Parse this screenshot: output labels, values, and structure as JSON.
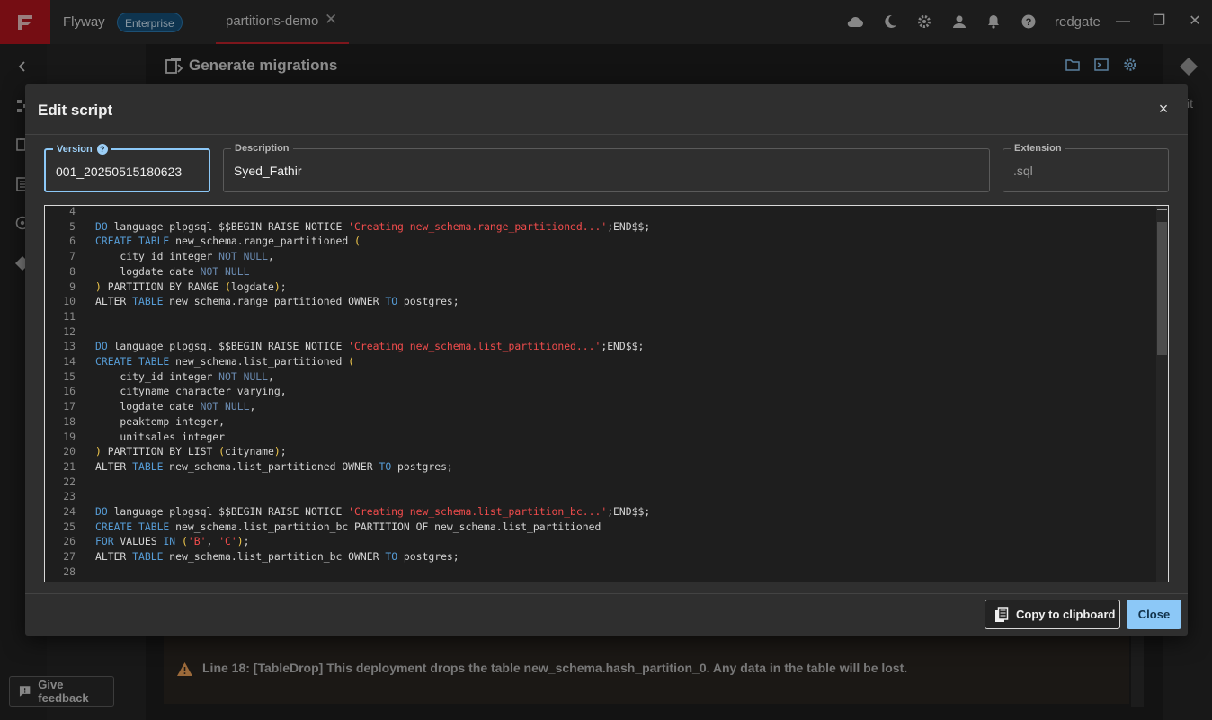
{
  "titlebar": {
    "app_name": "Flyway",
    "edition_badge": "Enterprise",
    "tab_label": "partitions-demo",
    "tab_close": "✕",
    "user": "redgate",
    "minimize": "—",
    "maximize": "❐",
    "close": "✕"
  },
  "background": {
    "page_title": "Generate migrations",
    "right_rail_text": "it",
    "warning_text": "Line 18: [TableDrop] This deployment drops the table new_schema.hash_partition_0. Any data in the table will be lost.",
    "feedback_label": "Give feedback"
  },
  "modal": {
    "title": "Edit script",
    "close_glyph": "×",
    "version": {
      "label": "Version",
      "help": "?",
      "value": "001_20250515180623"
    },
    "description": {
      "label": "Description",
      "value": "Syed_Fathir"
    },
    "extension": {
      "label": "Extension",
      "value": ".sql"
    },
    "copy_button": "Copy to clipboard",
    "close_button": "Close"
  },
  "code_lines": [
    {
      "n": "4",
      "tokens": []
    },
    {
      "n": "5",
      "tokens": [
        {
          "t": "kw",
          "s": "DO"
        },
        {
          "t": "",
          "s": " language plpgsql $$BEGIN RAISE NOTICE "
        },
        {
          "t": "str",
          "s": "'Creating new_schema.range_partitioned...'"
        },
        {
          "t": "",
          "s": ";END$$;"
        }
      ]
    },
    {
      "n": "6",
      "tokens": [
        {
          "t": "kw",
          "s": "CREATE TABLE"
        },
        {
          "t": "",
          "s": " new_schema.range_partitioned "
        },
        {
          "t": "par",
          "s": "("
        }
      ]
    },
    {
      "n": "7",
      "tokens": [
        {
          "t": "",
          "s": "    city_id integer "
        },
        {
          "t": "gr",
          "s": "NOT NULL"
        },
        {
          "t": "",
          "s": ","
        }
      ]
    },
    {
      "n": "8",
      "tokens": [
        {
          "t": "",
          "s": "    logdate date "
        },
        {
          "t": "gr",
          "s": "NOT NULL"
        }
      ]
    },
    {
      "n": "9",
      "tokens": [
        {
          "t": "par",
          "s": ")"
        },
        {
          "t": "",
          "s": " PARTITION BY RANGE "
        },
        {
          "t": "par",
          "s": "("
        },
        {
          "t": "",
          "s": "logdate"
        },
        {
          "t": "par",
          "s": ")"
        },
        {
          "t": "",
          "s": ";"
        }
      ]
    },
    {
      "n": "10",
      "tokens": [
        {
          "t": "",
          "s": "ALTER "
        },
        {
          "t": "kw",
          "s": "TABLE"
        },
        {
          "t": "",
          "s": " new_schema.range_partitioned OWNER "
        },
        {
          "t": "kw",
          "s": "TO"
        },
        {
          "t": "",
          "s": " postgres;"
        }
      ]
    },
    {
      "n": "11",
      "tokens": []
    },
    {
      "n": "12",
      "tokens": []
    },
    {
      "n": "13",
      "tokens": [
        {
          "t": "kw",
          "s": "DO"
        },
        {
          "t": "",
          "s": " language plpgsql $$BEGIN RAISE NOTICE "
        },
        {
          "t": "str",
          "s": "'Creating new_schema.list_partitioned...'"
        },
        {
          "t": "",
          "s": ";END$$;"
        }
      ]
    },
    {
      "n": "14",
      "tokens": [
        {
          "t": "kw",
          "s": "CREATE TABLE"
        },
        {
          "t": "",
          "s": " new_schema.list_partitioned "
        },
        {
          "t": "par",
          "s": "("
        }
      ]
    },
    {
      "n": "15",
      "tokens": [
        {
          "t": "",
          "s": "    city_id integer "
        },
        {
          "t": "gr",
          "s": "NOT NULL"
        },
        {
          "t": "",
          "s": ","
        }
      ]
    },
    {
      "n": "16",
      "tokens": [
        {
          "t": "",
          "s": "    cityname character varying,"
        }
      ]
    },
    {
      "n": "17",
      "tokens": [
        {
          "t": "",
          "s": "    logdate date "
        },
        {
          "t": "gr",
          "s": "NOT NULL"
        },
        {
          "t": "",
          "s": ","
        }
      ]
    },
    {
      "n": "18",
      "tokens": [
        {
          "t": "",
          "s": "    peaktemp integer,"
        }
      ]
    },
    {
      "n": "19",
      "tokens": [
        {
          "t": "",
          "s": "    unitsales integer"
        }
      ]
    },
    {
      "n": "20",
      "tokens": [
        {
          "t": "par",
          "s": ")"
        },
        {
          "t": "",
          "s": " PARTITION BY LIST "
        },
        {
          "t": "par",
          "s": "("
        },
        {
          "t": "",
          "s": "cityname"
        },
        {
          "t": "par",
          "s": ")"
        },
        {
          "t": "",
          "s": ";"
        }
      ]
    },
    {
      "n": "21",
      "tokens": [
        {
          "t": "",
          "s": "ALTER "
        },
        {
          "t": "kw",
          "s": "TABLE"
        },
        {
          "t": "",
          "s": " new_schema.list_partitioned OWNER "
        },
        {
          "t": "kw",
          "s": "TO"
        },
        {
          "t": "",
          "s": " postgres;"
        }
      ]
    },
    {
      "n": "22",
      "tokens": []
    },
    {
      "n": "23",
      "tokens": []
    },
    {
      "n": "24",
      "tokens": [
        {
          "t": "kw",
          "s": "DO"
        },
        {
          "t": "",
          "s": " language plpgsql $$BEGIN RAISE NOTICE "
        },
        {
          "t": "str",
          "s": "'Creating new_schema.list_partition_bc...'"
        },
        {
          "t": "",
          "s": ";END$$;"
        }
      ]
    },
    {
      "n": "25",
      "tokens": [
        {
          "t": "kw",
          "s": "CREATE TABLE"
        },
        {
          "t": "",
          "s": " new_schema.list_partition_bc PARTITION OF new_schema.list_partitioned"
        }
      ]
    },
    {
      "n": "26",
      "tokens": [
        {
          "t": "kw",
          "s": "FOR"
        },
        {
          "t": "",
          "s": " VALUES "
        },
        {
          "t": "kw",
          "s": "IN"
        },
        {
          "t": "",
          "s": " "
        },
        {
          "t": "par",
          "s": "("
        },
        {
          "t": "str",
          "s": "'B'"
        },
        {
          "t": "",
          "s": ", "
        },
        {
          "t": "str",
          "s": "'C'"
        },
        {
          "t": "par",
          "s": ")"
        },
        {
          "t": "",
          "s": ";"
        }
      ]
    },
    {
      "n": "27",
      "tokens": [
        {
          "t": "",
          "s": "ALTER "
        },
        {
          "t": "kw",
          "s": "TABLE"
        },
        {
          "t": "",
          "s": " new_schema.list_partition_bc OWNER "
        },
        {
          "t": "kw",
          "s": "TO"
        },
        {
          "t": "",
          "s": " postgres;"
        }
      ]
    },
    {
      "n": "28",
      "tokens": []
    }
  ],
  "colors": {
    "accent": "#8cc8f7",
    "brand": "#b4141e",
    "keyword": "#569cd6",
    "string": "#f14c4c",
    "paren": "#f2c94c"
  }
}
